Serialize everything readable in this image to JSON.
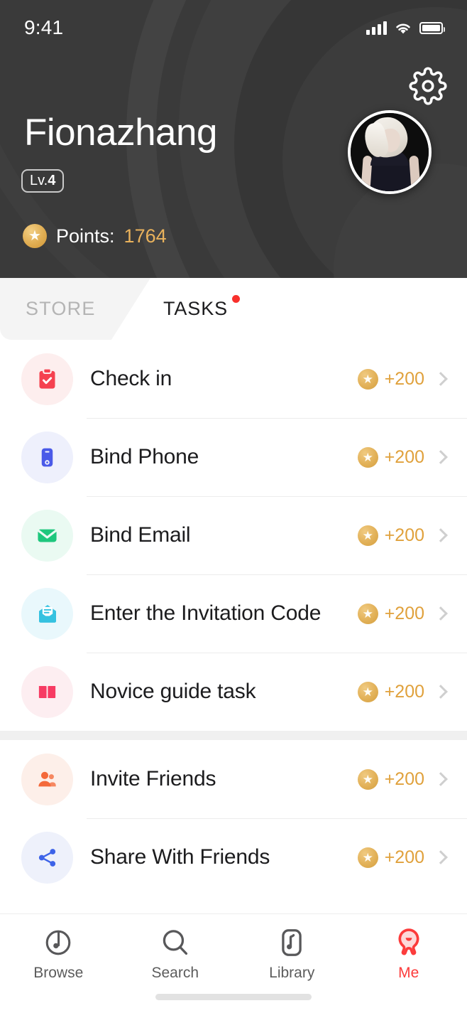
{
  "status_bar": {
    "time": "9:41",
    "signal_icon": "cellular-signal-icon",
    "wifi_icon": "wifi-icon",
    "battery_icon": "battery-icon"
  },
  "header": {
    "settings_icon": "gear-icon",
    "username": "Fionazhang",
    "level_prefix": "Lv.",
    "level_value": "4",
    "points_label": "Points:",
    "points_value": "1764",
    "points_icon": "star-coin-icon",
    "avatar_name": "avatar",
    "background_color": "#3a3a3a",
    "points_accent": "#e9b25c"
  },
  "tabs": [
    {
      "label": "STORE",
      "active": false,
      "badge": false
    },
    {
      "label": "TASKS",
      "active": true,
      "badge": true
    }
  ],
  "tab_badge_color": "#f8302c",
  "sections": [
    {
      "tasks": [
        {
          "label": "Check in",
          "reward": "+200",
          "icon": "clipboard-check-icon",
          "icon_color": "#f5414f",
          "icon_bg": "#fdeeee"
        },
        {
          "label": "Bind Phone",
          "reward": "+200",
          "icon": "phone-icon",
          "icon_color": "#4a5ae8",
          "icon_bg": "#eef0fc"
        },
        {
          "label": "Bind Email",
          "reward": "+200",
          "icon": "envelope-icon",
          "icon_color": "#1ec77d",
          "icon_bg": "#eafaf2"
        },
        {
          "label": "Enter the Invitation Code",
          "reward": "+200",
          "icon": "invitation-envelope-icon",
          "icon_color": "#35c2e0",
          "icon_bg": "#e9f8fc"
        },
        {
          "label": "Novice guide task",
          "reward": "+200",
          "icon": "open-book-icon",
          "icon_color": "#f73b63",
          "icon_bg": "#fdeef1"
        }
      ]
    },
    {
      "tasks": [
        {
          "label": "Invite Friends",
          "reward": "+200",
          "icon": "people-icon",
          "icon_color": "#f4693a",
          "icon_bg": "#fdefe9"
        },
        {
          "label": "Share With Friends",
          "reward": "+200",
          "icon": "share-icon",
          "icon_color": "#3d63e8",
          "icon_bg": "#eef1fb"
        }
      ]
    }
  ],
  "reward_accent": "#e0a13c",
  "bottom_nav": [
    {
      "label": "Browse",
      "icon": "browse-disc-icon",
      "active": false
    },
    {
      "label": "Search",
      "icon": "search-icon",
      "active": false
    },
    {
      "label": "Library",
      "icon": "library-note-icon",
      "active": false
    },
    {
      "label": "Me",
      "icon": "profile-me-icon",
      "active": true
    }
  ],
  "active_nav_color": "#fc3b3b"
}
